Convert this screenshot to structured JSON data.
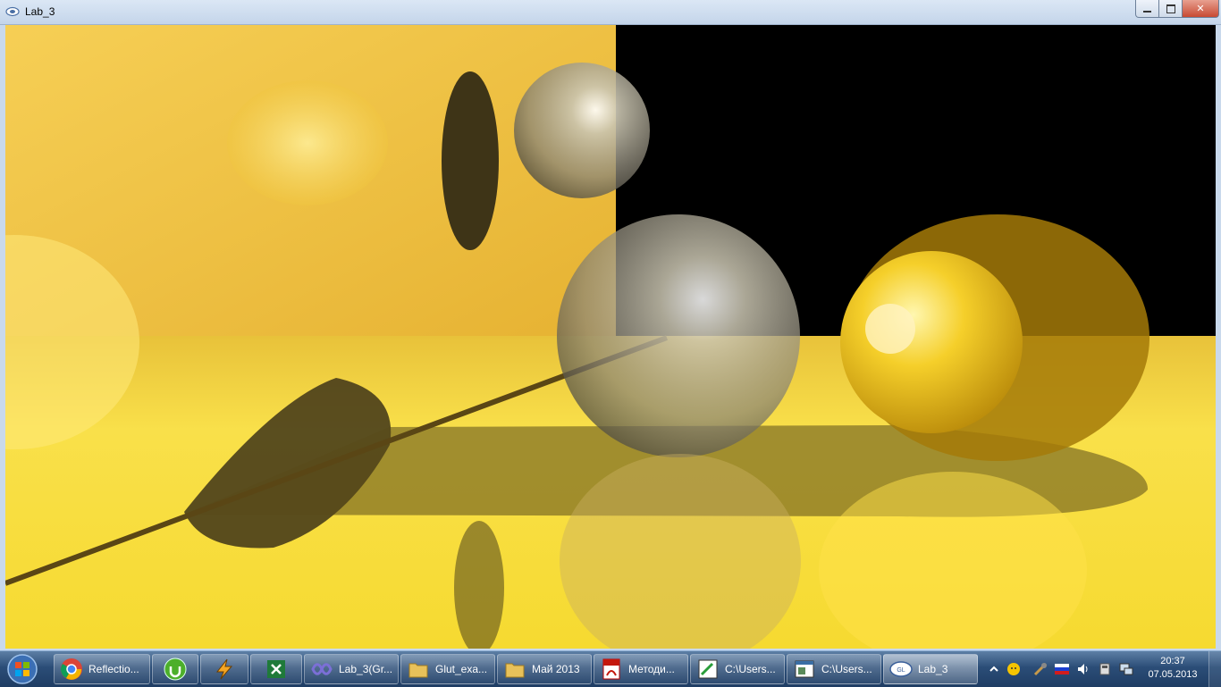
{
  "window": {
    "title": "Lab_3",
    "minimize_icon": "minimize-icon",
    "maximize_icon": "maximize-icon",
    "close_icon": "close-icon"
  },
  "scene": {
    "description_icon": "opengl-render",
    "colors": {
      "wall": "#f5c84a",
      "floor": "#f3d23a",
      "background": "#000000",
      "glass_sphere": "#a8a8a8",
      "gold_sphere": "#e6b820"
    }
  },
  "taskbar": {
    "start_icon": "windows-start-icon",
    "items": [
      {
        "label": "Reflectio...",
        "icon": "chrome-icon"
      },
      {
        "label": "",
        "icon": "utorrent-icon"
      },
      {
        "label": "",
        "icon": "winamp-icon"
      },
      {
        "label": "",
        "icon": "excel-icon"
      },
      {
        "label": "Lab_3(Gr...",
        "icon": "visual-studio-icon"
      },
      {
        "label": "Glut_exa...",
        "icon": "folder-icon"
      },
      {
        "label": "Май 2013",
        "icon": "folder-icon"
      },
      {
        "label": "Методи...",
        "icon": "pdf-icon"
      },
      {
        "label": "C:\\Users...",
        "icon": "console-icon"
      },
      {
        "label": "C:\\Users...",
        "icon": "window-app-icon"
      },
      {
        "label": "Lab_3",
        "icon": "opengl-icon"
      }
    ],
    "tray": {
      "icons": [
        "show-hidden-icons-icon",
        "messenger-icon",
        "network-tool-icon",
        "language-ru-icon",
        "volume-icon",
        "device-icon",
        "network-icon"
      ],
      "time": "20:37",
      "date": "07.05.2013"
    }
  }
}
